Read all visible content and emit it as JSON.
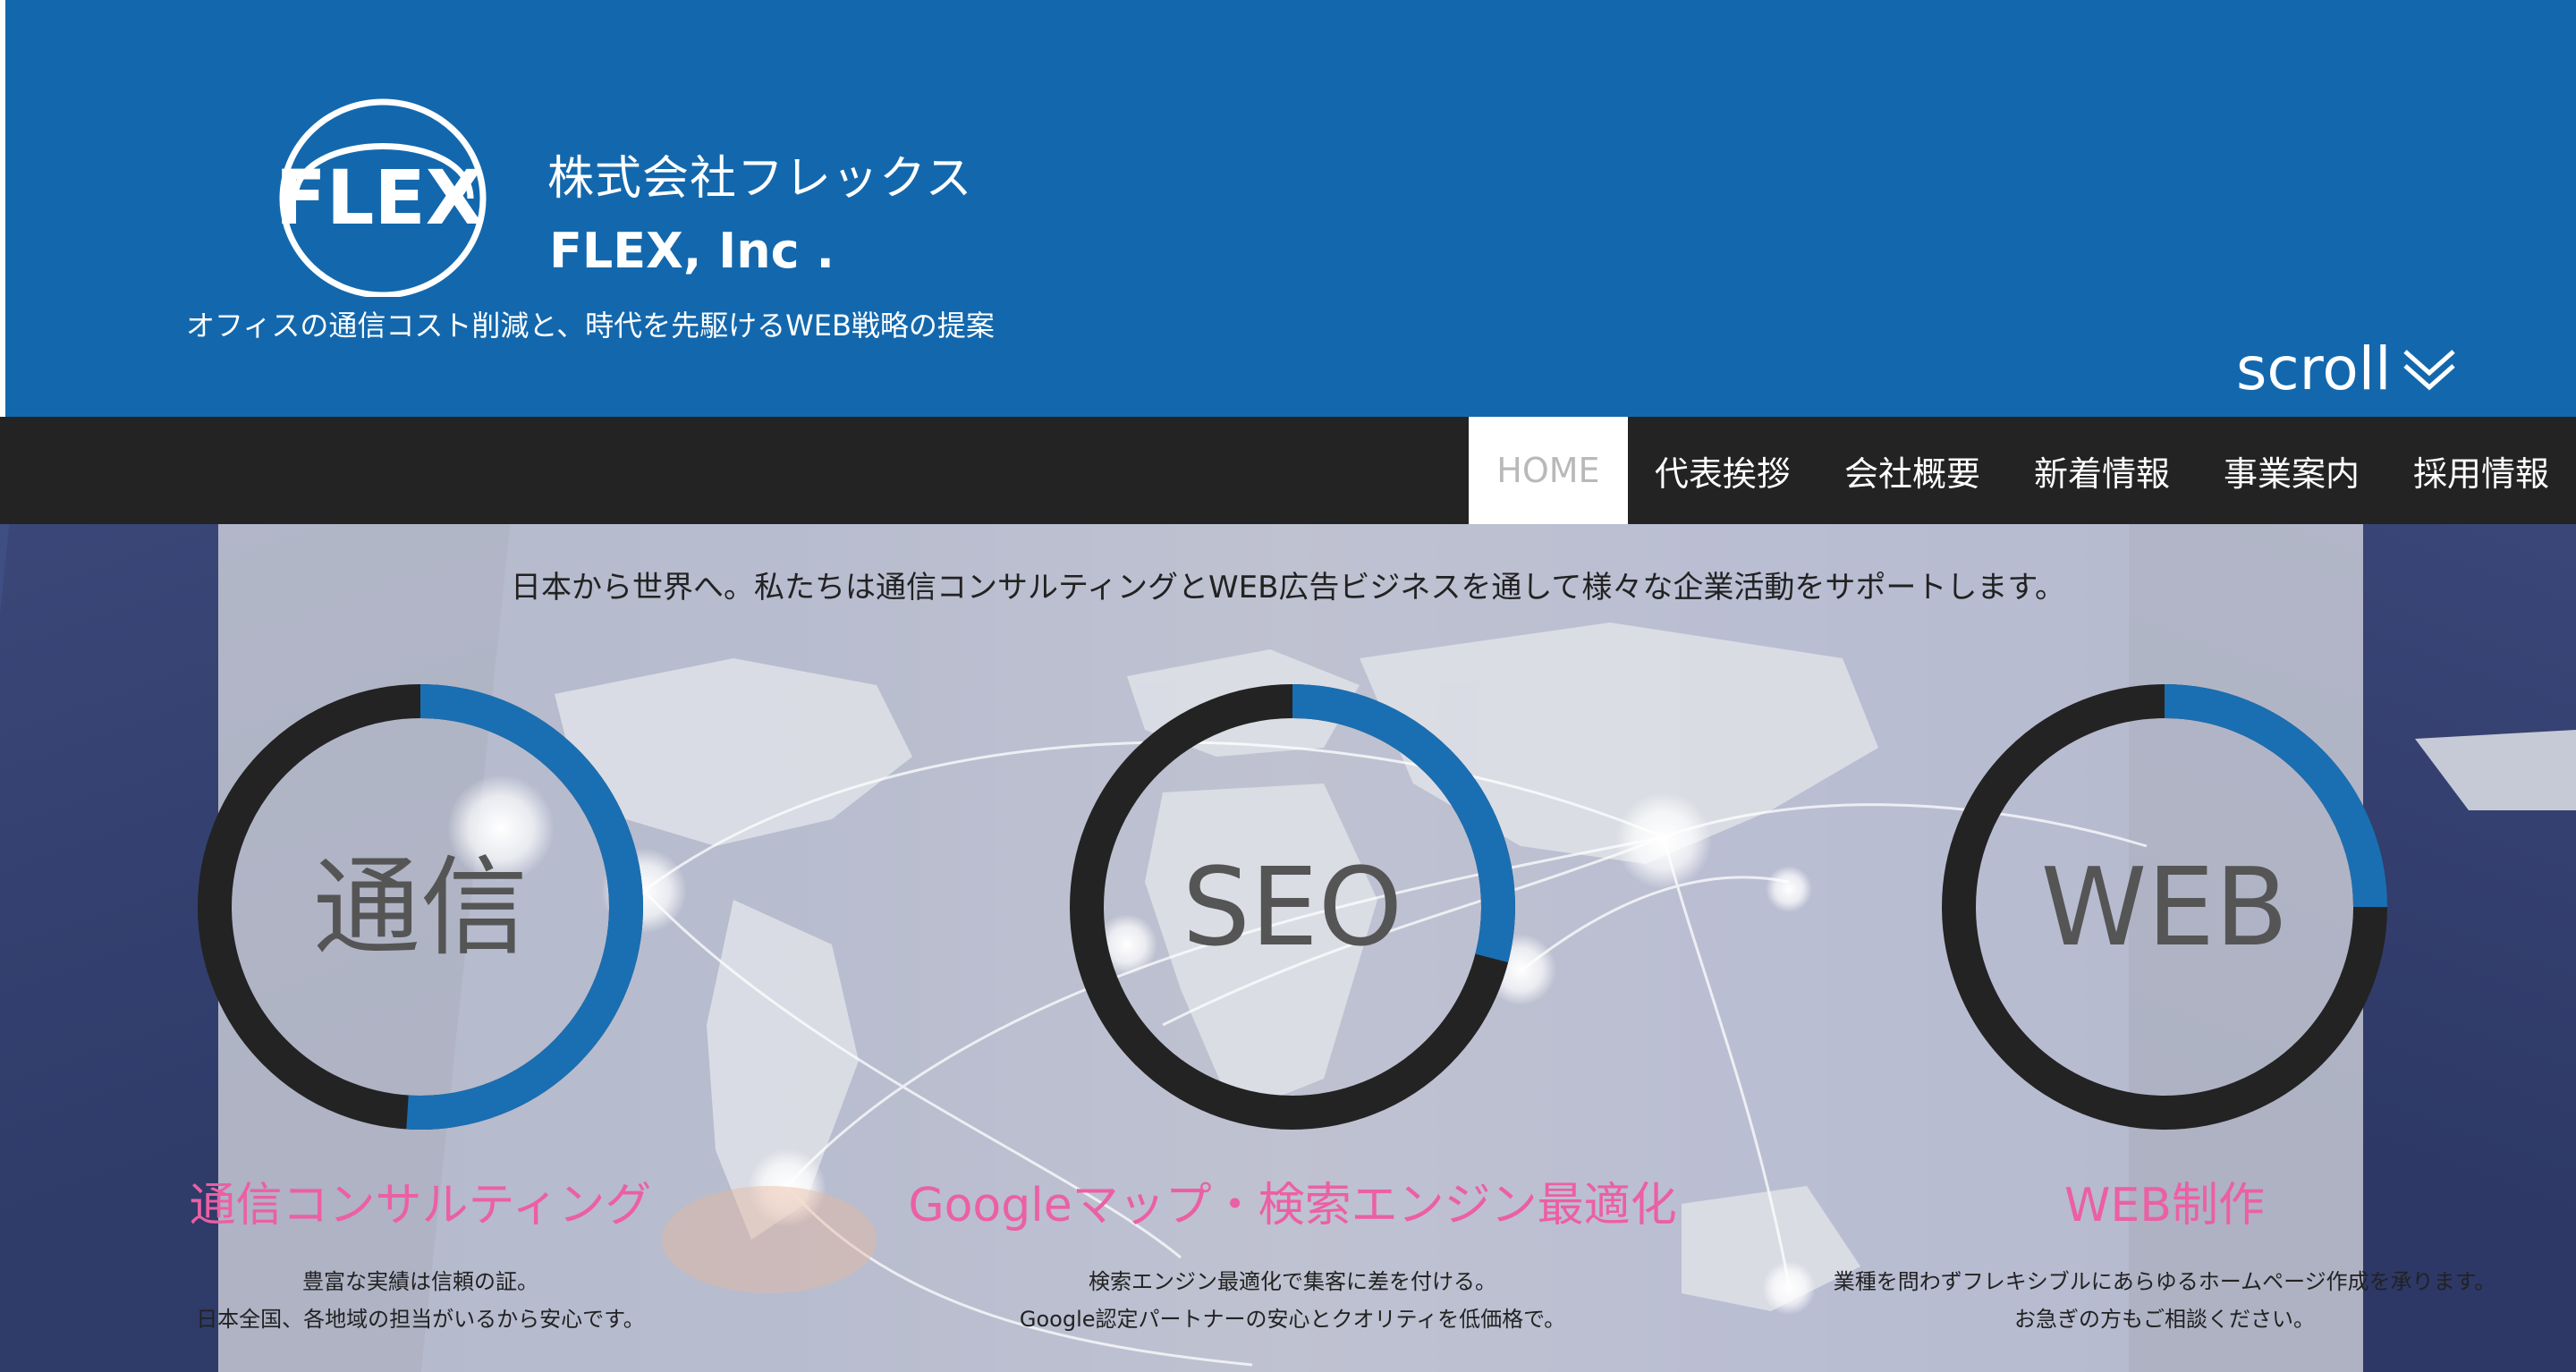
{
  "header": {
    "company_name_ja": "株式会社フレックス",
    "company_name_en": "FLEX, Inc .",
    "logo_text": "FLEX",
    "tagline": "オフィスの通信コスト削減と、時代を先駆けるWEB戦略の提案",
    "scroll_label": "scroll"
  },
  "nav": {
    "items": [
      {
        "label": "HOME",
        "active": true
      },
      {
        "label": "代表挨拶",
        "active": false
      },
      {
        "label": "会社概要",
        "active": false
      },
      {
        "label": "新着情報",
        "active": false
      },
      {
        "label": "事業案内",
        "active": false
      },
      {
        "label": "採用情報",
        "active": false
      }
    ]
  },
  "hero": {
    "intro": "日本から世界へ。私たちは通信コンサルティングとWEB広告ビジネスを通して様々な企業活動をサポートします。",
    "services": [
      {
        "ring_label": "通信",
        "progress": 0.51,
        "title": "通信コンサルティング",
        "desc_line1": "豊富な実績は信頼の証。",
        "desc_line2": "日本全国、各地域の担当がいるから安心です。"
      },
      {
        "ring_label": "SEO",
        "progress": 0.29,
        "title": "Googleマップ・検索エンジン最適化",
        "desc_line1": "検索エンジン最適化で集客に差を付ける。",
        "desc_line2": "Google認定パートナーの安心とクオリティを低価格で。"
      },
      {
        "ring_label": "WEB",
        "progress": 0.25,
        "title": "WEB制作",
        "desc_line1": "業種を問わずフレキシブルにあらゆるホームページ作成を承ります。",
        "desc_line2": "お急ぎの方もご相談ください。"
      }
    ]
  },
  "colors": {
    "header_blue": "#1368ad",
    "ring_blue": "#1a6fb3",
    "ring_dark": "#232323",
    "accent_pink": "#ec5fa4",
    "nav_dark": "#232323"
  },
  "icons": {
    "logo": "flex-ring-logo",
    "scroll": "double-chevron-down-icon"
  }
}
